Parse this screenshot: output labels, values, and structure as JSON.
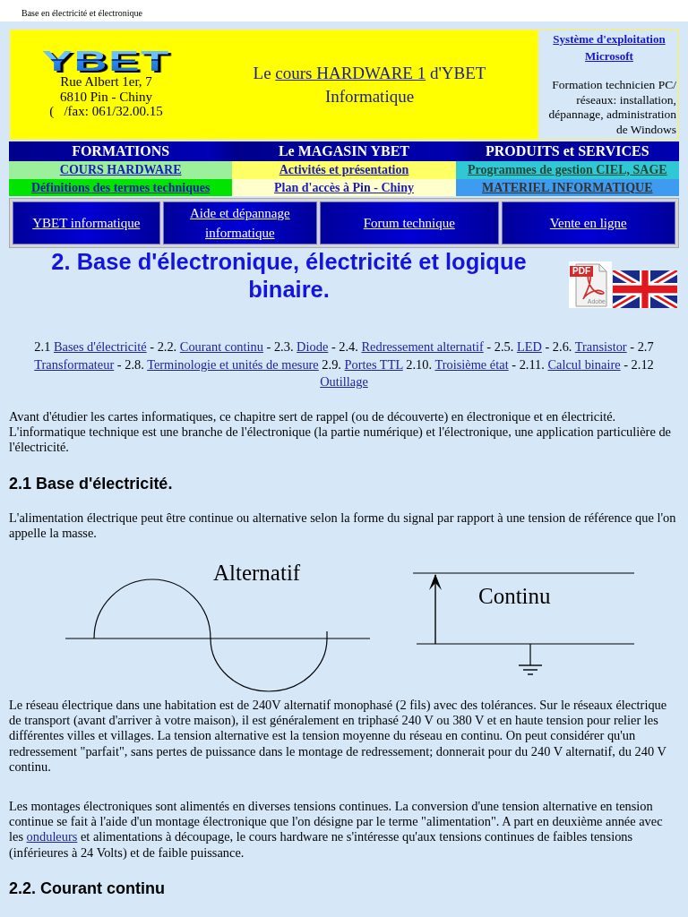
{
  "page_title": "Base en électricité et électronique",
  "header": {
    "logo": "YBET",
    "address": [
      "Rue Albert 1er, 7",
      "6810 Pin - Chiny",
      "(   /fax: 061/32.00.15"
    ],
    "tagline": {
      "before": "Le",
      "link": "cours HARDWARE 1",
      "after": "d'YBET Informatique"
    },
    "side_link": "Système d'exploitation Microsoft",
    "side_text": "Formation technicien PC/ réseaux: installation, dépannage, administration de Windows"
  },
  "nav": {
    "headings": [
      "FORMATIONS",
      "Le MAGASIN YBET",
      "PRODUITS et SERVICES"
    ],
    "rows": [
      [
        "COURS HARDWARE",
        "Activités et présentation",
        "Programmes de gestion CIEL, SAGE"
      ],
      [
        "Définitions des termes techniques",
        "Plan d'accès à Pin - Chiny",
        "MATERIEL INFORMATIQUE"
      ]
    ]
  },
  "buttons": [
    "YBET informatique",
    "Aide et dépannage informatique",
    "Forum technique",
    "Vente en ligne"
  ],
  "title": "2. Base d'électronique, électricité et logique binaire.",
  "pdf_icon": {
    "label": "PDF",
    "caption": "Adobe"
  },
  "toc": [
    {
      "number": "2.1",
      "link": "Bases d'électricité"
    },
    {
      "number": "- 2.2.",
      "link": "Courant continu"
    },
    {
      "number": "- 2.3.",
      "link": "Diode"
    },
    {
      "number": "- 2.4.",
      "link": "Redressement alternatif"
    },
    {
      "number": "- 2.5.",
      "link": "LED"
    },
    {
      "number": "- 2.6.",
      "link": "Transistor"
    },
    {
      "number": "- 2.7",
      "link": "Transformateur"
    },
    {
      "number": "- 2.8.",
      "link": "Terminologie et unités de mesure"
    },
    {
      "number": "2.9.",
      "link": "Portes TTL"
    },
    {
      "number": "2.10.",
      "link": "Troisième état"
    },
    {
      "number": "- 2.11.",
      "link": "Calcul binaire"
    },
    {
      "number": "- 2.12",
      "link": "Outillage"
    }
  ],
  "content": [
    {
      "kind": "paragraph",
      "lines": [
        "Avant d'étudier les cartes informatiques, ce chapitre sert de rappel (ou de découverte) en électronique et en électricité.",
        "L'informatique technique est une branche de l'électronique (la partie numérique) et l'électronique, une application particulière de l'électricité."
      ]
    },
    {
      "kind": "heading",
      "text": "2.1 Base d'électricité."
    },
    {
      "kind": "paragraph",
      "lines": [
        "L'alimentation électrique peut être continue ou alternative selon la forme du signal par rapport à une tension de référence que l'on appelle la masse."
      ]
    },
    {
      "kind": "figure",
      "diagrams": [
        {
          "kind": "alternating",
          "label": "Alternatif"
        },
        {
          "kind": "direct",
          "label": "Continu"
        }
      ]
    },
    {
      "kind": "paragraph",
      "lines": [
        "Le réseau électrique dans une habitation est de 240V alternatif monophasé (2 fils) avec des tolérances. Sur le réseaux électrique de transport (avant d'arriver à votre maison), il est généralement en triphasé 240 V ou 380 V et en haute tension pour relier les différentes villes et villages. La tension alternative est la tension moyenne du réseau en continu. On peut considérer qu'un redressement \"parfait\", sans pertes de puissance dans le montage de redressement; donnerait pour du 240 V alternatif, du 240 V continu."
      ]
    },
    {
      "kind": "linked_paragraph",
      "before": "Les montages électroniques sont alimentés en diverses tensions continues. La conversion d'une tension alternative en tension continue se fait à l'aide d'un montage électronique que l'on désigne par le terme \"alimentation\". A part en deuxième année avec les",
      "link": "onduleurs",
      "after": "et alimentations à découpage, le cours hardware ne s'intéresse qu'aux tensions continues de faibles tensions (inférieures à 24 Volts) et de faible puissance."
    },
    {
      "kind": "heading",
      "text": "2.2. Courant continu"
    }
  ]
}
